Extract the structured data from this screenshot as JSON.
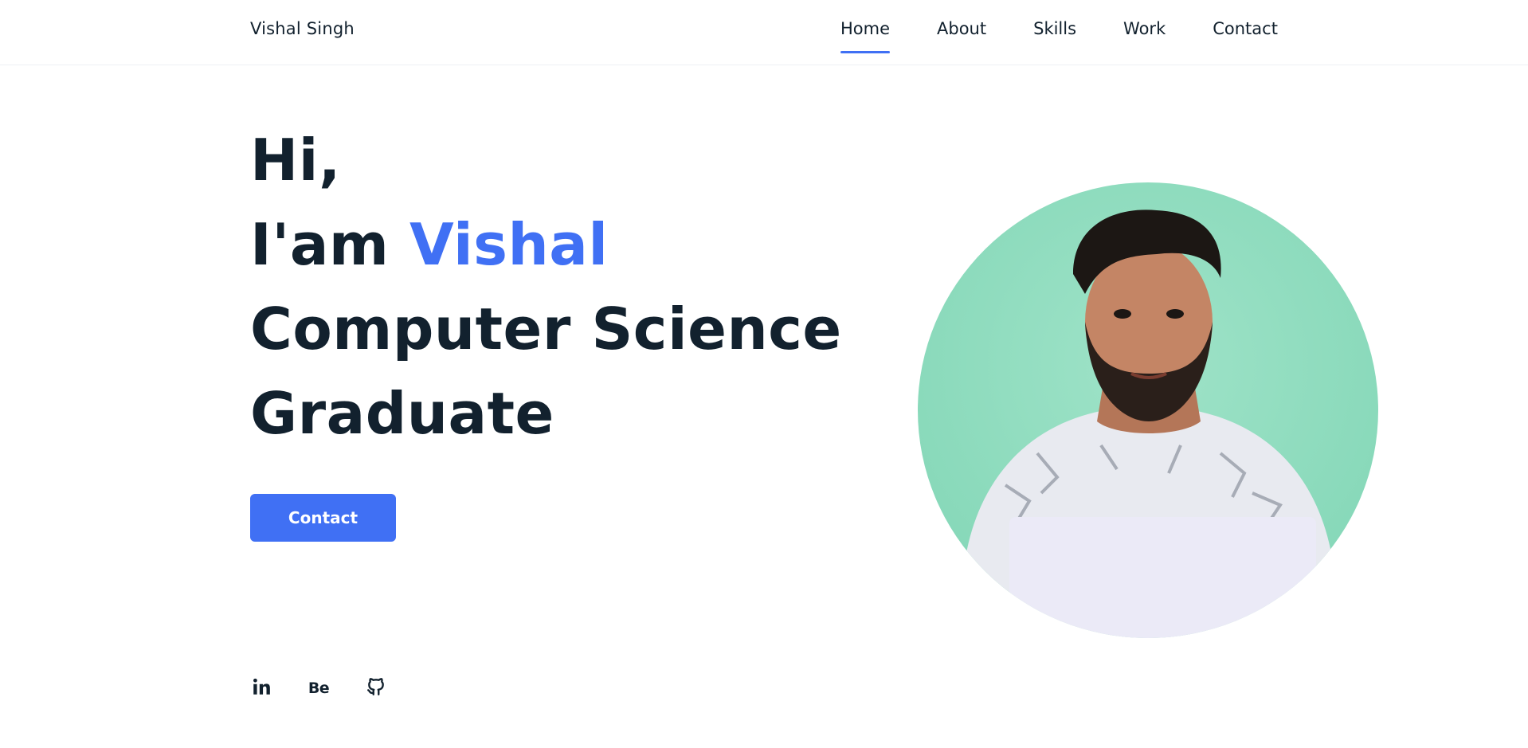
{
  "header": {
    "logo": "Vishal Singh",
    "nav": [
      {
        "label": "Home",
        "active": true
      },
      {
        "label": "About",
        "active": false
      },
      {
        "label": "Skills",
        "active": false
      },
      {
        "label": "Work",
        "active": false
      },
      {
        "label": "Contact",
        "active": false
      }
    ]
  },
  "hero": {
    "greeting": "Hi,",
    "intro": "I'am",
    "name": "Vishal",
    "title_line1": "Computer Science",
    "title_line2": "Graduate",
    "cta_label": "Contact"
  },
  "social": [
    {
      "icon": "linkedin-icon",
      "label": "in"
    },
    {
      "icon": "behance-icon",
      "label": "Be"
    },
    {
      "icon": "github-icon"
    }
  ],
  "colors": {
    "accent": "#4070f4",
    "text": "#12212e",
    "background": "#ffffff",
    "portrait_bg": "#8fdcbf"
  }
}
